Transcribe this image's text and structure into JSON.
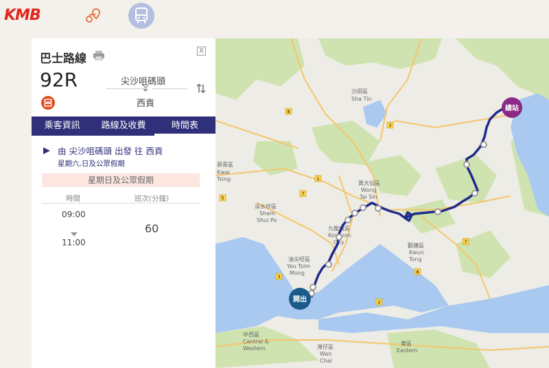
{
  "header": {
    "logo": "KMB",
    "icons": [
      "route-planner-icon",
      "bus-route-icon"
    ]
  },
  "panel": {
    "title": "巴士路線",
    "route_no": "92R",
    "origin": "尖沙咀碼頭",
    "destination": "西貢",
    "tabs": [
      "乘客資訊",
      "路線及收費",
      "時間表"
    ],
    "active_tab": "時間表",
    "direction_text": "由 尖沙咀碼頭 出發 往 西貢",
    "direction_sub": "星期六,日及公眾假期",
    "day_band": "星期日及公眾假期",
    "col_time": "時間",
    "col_freq": "班次(分鐘)",
    "time_start": "09:00",
    "time_end": "11:00",
    "frequency": "60",
    "close": "X"
  },
  "map": {
    "start_label": "開出",
    "end_label": "總站",
    "labels": {
      "shatin_cn": "沙田區",
      "shatin_en": "Sha Tin",
      "kwaitsing_cn": "葵青區",
      "kwaitsing_en1": "Kwai",
      "kwaitsing_en2": "Tsing",
      "wts_cn": "黃大仙區",
      "wts_en1": "Wong",
      "wts_en2": "Tai Sin",
      "ssp_cn": "深水埗區",
      "ssp_en1": "Sham",
      "ssp_en2": "Shui Po",
      "kc_cn": "九龍城區",
      "kc_en1": "Kowloon",
      "kc_en2": "City",
      "kt_cn": "觀塘區",
      "kt_en1": "Kwun",
      "kt_en2": "Tong",
      "ytm_cn": "油尖旺區",
      "ytm_en1": "Yau Tsim",
      "ytm_en2": "Mong",
      "cw_cn": "中西區",
      "cw_en1": "Central &",
      "cw_en2": "Western",
      "wc_cn": "灣仔區",
      "wc_en1": "Wan",
      "wc_en2": "Chai",
      "east_cn": "東區",
      "east_en": "Eastern"
    },
    "route_numbers": [
      "8",
      "2",
      "1",
      "7",
      "5",
      "3",
      "7",
      "2",
      "8"
    ],
    "colors": {
      "route": "#1f2a8a",
      "start": "#1b5b89",
      "end": "#8b2a86",
      "water": "#a9c9f0",
      "green": "#cfe3b0"
    }
  }
}
